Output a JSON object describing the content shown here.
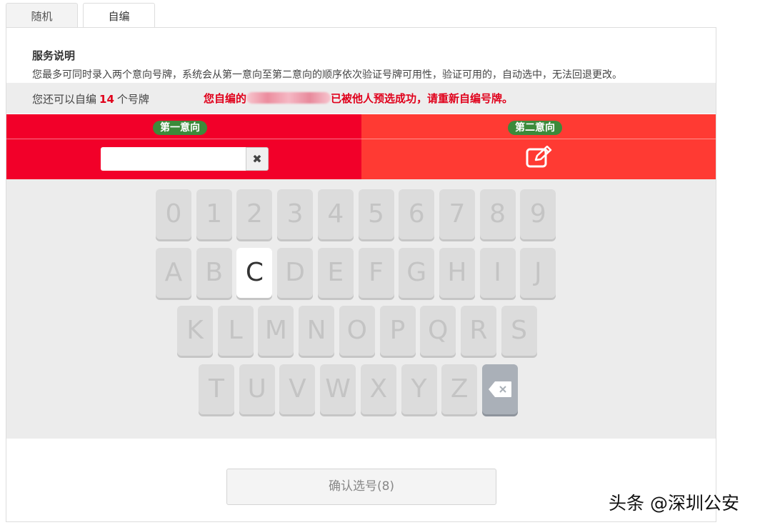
{
  "tabs": [
    {
      "label": "随机"
    },
    {
      "label": "自编"
    }
  ],
  "service": {
    "title": "服务说明",
    "text": "您最多可同时录入两个意向号牌，系统会从第一意向至第二意向的顺序依次验证号牌可用性，验证可用的，自动选中，无法回退更改。"
  },
  "remaining": {
    "prefix": "您还可以自编",
    "count": "14",
    "suffix": "个号牌"
  },
  "warning": {
    "prefix": "您自编的",
    "suffix": "已被他人预选成功，请重新自编号牌。"
  },
  "choices": {
    "first_label": "第一意向",
    "second_label": "第二意向",
    "first_value": "",
    "clear_symbol": "✖"
  },
  "keyboard": {
    "row1": [
      "0",
      "1",
      "2",
      "3",
      "4",
      "5",
      "6",
      "7",
      "8",
      "9"
    ],
    "row2": [
      "A",
      "B",
      "C",
      "D",
      "E",
      "F",
      "G",
      "H",
      "I",
      "J"
    ],
    "row3": [
      "K",
      "L",
      "M",
      "N",
      "O",
      "P",
      "Q",
      "R",
      "S"
    ],
    "row4": [
      "T",
      "U",
      "V",
      "W",
      "X",
      "Y",
      "Z"
    ],
    "selected": "C"
  },
  "confirm_label": "确认选号(8)",
  "watermark": "头条 @深圳公安",
  "colors": {
    "first_bg": "#f20029",
    "second_bg": "#ff3a33",
    "pill": "#3c8a3a",
    "accent": "#e0001b"
  },
  "icons": {
    "edit": "edit-icon",
    "clear": "close-icon",
    "backspace": "backspace-icon"
  }
}
